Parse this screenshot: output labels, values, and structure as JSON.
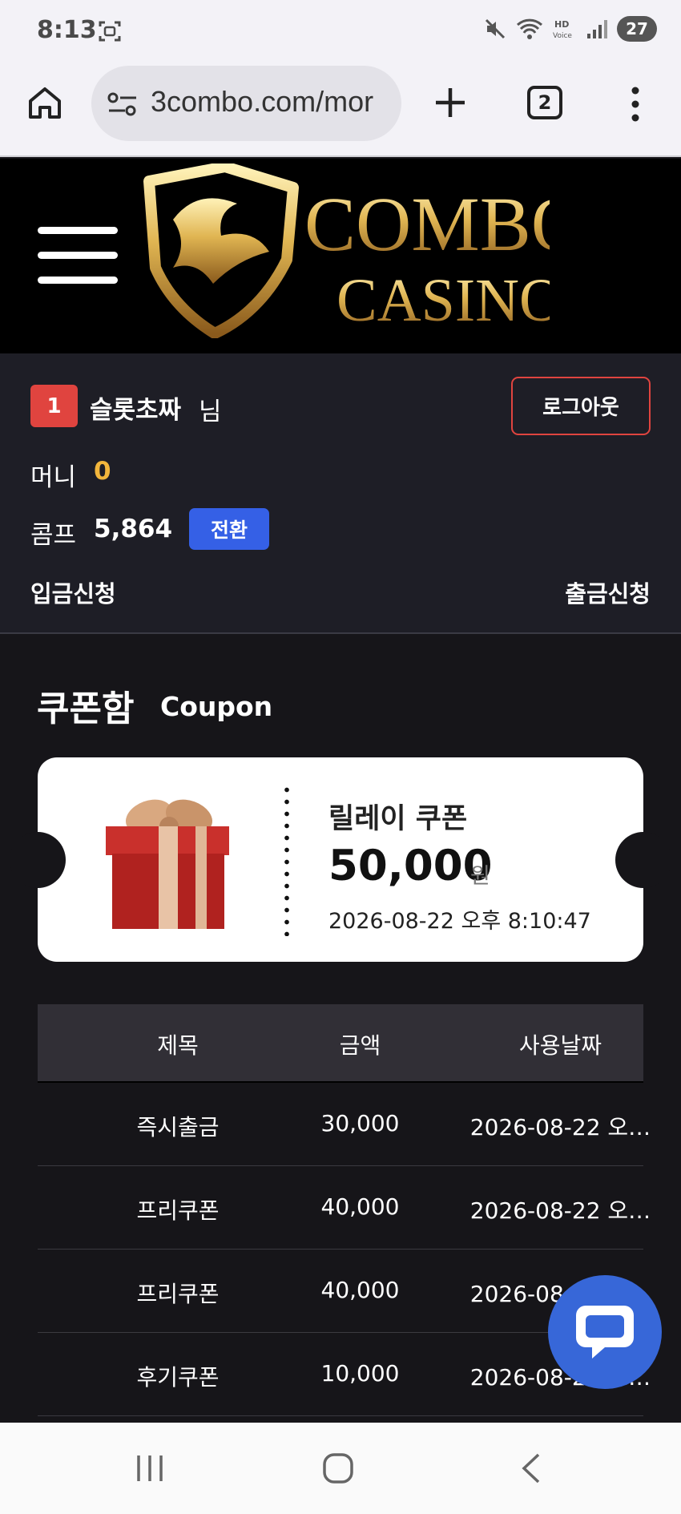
{
  "status_bar": {
    "time": "8:13",
    "battery": "27",
    "icons": [
      "screenshot-icon",
      "mute-icon",
      "wifi-icon",
      "hd-voice-icon",
      "signal-icon"
    ]
  },
  "browser": {
    "url": "3combo.com/mor",
    "tab_count": "2"
  },
  "site": {
    "brand_line1": "COMBO",
    "brand_line2": "CASINO"
  },
  "user": {
    "level": "1",
    "name": "슬롯초짜",
    "honorific": "님",
    "logout_label": "로그아웃",
    "money_label": "머니",
    "money_value": "0",
    "comp_label": "콤프",
    "comp_value": "5,864",
    "convert_label": "전환",
    "deposit_label": "입금신청",
    "withdraw_label": "출금신청"
  },
  "coupon_section": {
    "title": "쿠폰함",
    "subtitle": "Coupon",
    "featured": {
      "name": "릴레이 쿠폰",
      "amount": "50,000",
      "unit": "원",
      "date": "2026-08-22 오후 8:10:47"
    }
  },
  "table": {
    "headers": [
      "제목",
      "금액",
      "사용날짜"
    ],
    "rows": [
      {
        "title": "즉시출금",
        "amount": "30,000",
        "date": "2026-08-22 오…"
      },
      {
        "title": "프리쿠폰",
        "amount": "40,000",
        "date": "2026-08-22 오…"
      },
      {
        "title": "프리쿠폰",
        "amount": "40,000",
        "date": "2026-08-22 오…"
      },
      {
        "title": "후기쿠폰",
        "amount": "10,000",
        "date": "2026-08-22 오…"
      }
    ]
  },
  "colors": {
    "accent_red": "#e0443f",
    "accent_blue": "#3560e6",
    "money_gold": "#f2b63c",
    "chat_blue": "#3767d8"
  }
}
